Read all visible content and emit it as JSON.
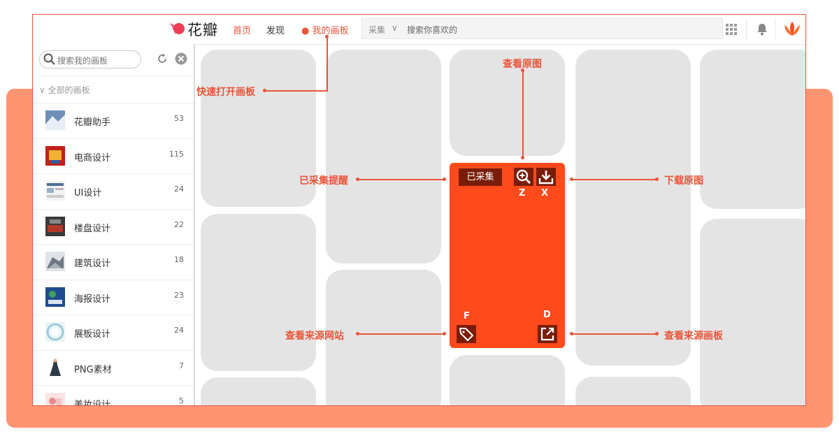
{
  "header": {
    "logo_text": "花瓣",
    "nav": {
      "home": "首页",
      "discover": "发现",
      "my_boards": "● 我的画板"
    },
    "search": {
      "scope": "采集",
      "placeholder": "搜索你喜欢的"
    }
  },
  "sidebar": {
    "search_placeholder": "搜索我的画板",
    "all_boards_label": "∨ 全部的画板",
    "boards": [
      {
        "name": "花瓣助手",
        "count": "53"
      },
      {
        "name": "电商设计",
        "count": "115"
      },
      {
        "name": "UI设计",
        "count": "24"
      },
      {
        "name": "楼盘设计",
        "count": "22"
      },
      {
        "name": "建筑设计",
        "count": "18"
      },
      {
        "name": "海报设计",
        "count": "23"
      },
      {
        "name": "展板设计",
        "count": "24"
      },
      {
        "name": "PNG素材",
        "count": "7"
      },
      {
        "name": "美妆设计",
        "count": "5"
      }
    ]
  },
  "card": {
    "collected_badge": "已采集",
    "keys": {
      "zoom": "Z",
      "download": "X",
      "source_site": "F",
      "source_board": "D"
    }
  },
  "annotations": {
    "quick_open_board": "快速打开画板",
    "view_original": "查看原图",
    "collected_reminder": "已采集提醒",
    "download_original": "下载原图",
    "view_source_site": "查看来源网站",
    "view_source_board": "查看来源画板"
  },
  "colors": {
    "accent": "#e8553a",
    "card": "#ff4a1c",
    "card_dark": "#7a1d08",
    "backdrop": "#ff9473",
    "tile": "#e4e4e4"
  }
}
